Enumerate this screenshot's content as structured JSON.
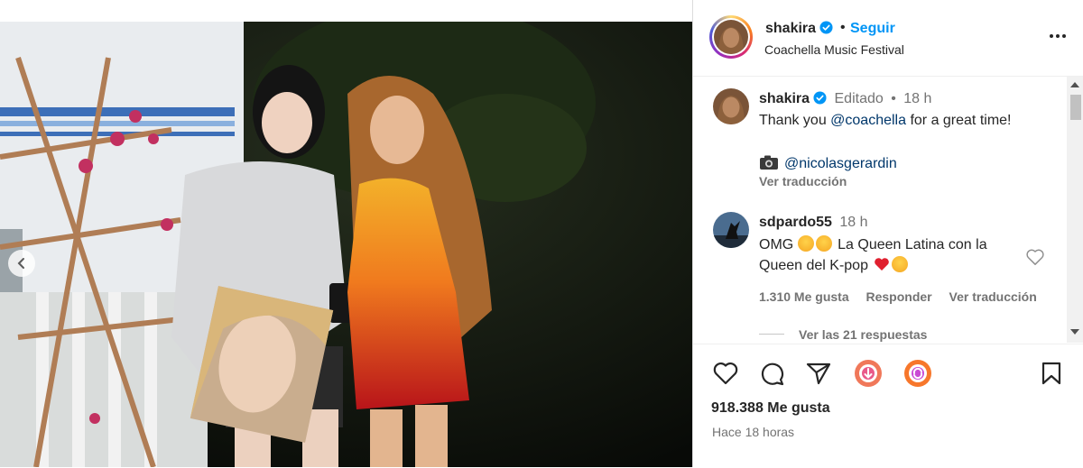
{
  "post": {
    "username": "shakira",
    "dot": "•",
    "follow_label": "Seguir",
    "location": "Coachella Music Festival"
  },
  "caption": {
    "username": "shakira",
    "edited": "Editado",
    "dot": "•",
    "age": "18 h",
    "text_prefix": "Thank you ",
    "mention": "@coachella",
    "text_suffix": " for a great time!",
    "credit_mention": "@nicolasgerardin",
    "translate": "Ver traducción"
  },
  "comment": {
    "username": "sdpardo55",
    "age": "18 h",
    "line1_prefix": "OMG",
    "line1_suffix": "La Queen Latina con la",
    "line2": "Queen del K-pop",
    "likes": "1.310 Me gusta",
    "reply": "Responder",
    "translate": "Ver traducción",
    "replies": "Ver las 21 respuestas"
  },
  "footer": {
    "likes": "918.388 Me gusta",
    "time": "Hace 18 horas"
  },
  "colors": {
    "accent": "#0095f6",
    "verified": "#0095f6",
    "text": "#262626",
    "muted": "#737373",
    "link": "#00376b",
    "heart": "#ed4956"
  },
  "icons": [
    "chevron-left-icon",
    "verified-badge-icon",
    "more-options-icon",
    "camera-emoji-icon",
    "star-struck-emoji-icon",
    "red-heart-emoji-icon",
    "heart-icon",
    "comment-icon",
    "share-icon",
    "story-share-icon",
    "remix-icon",
    "bookmark-icon"
  ]
}
